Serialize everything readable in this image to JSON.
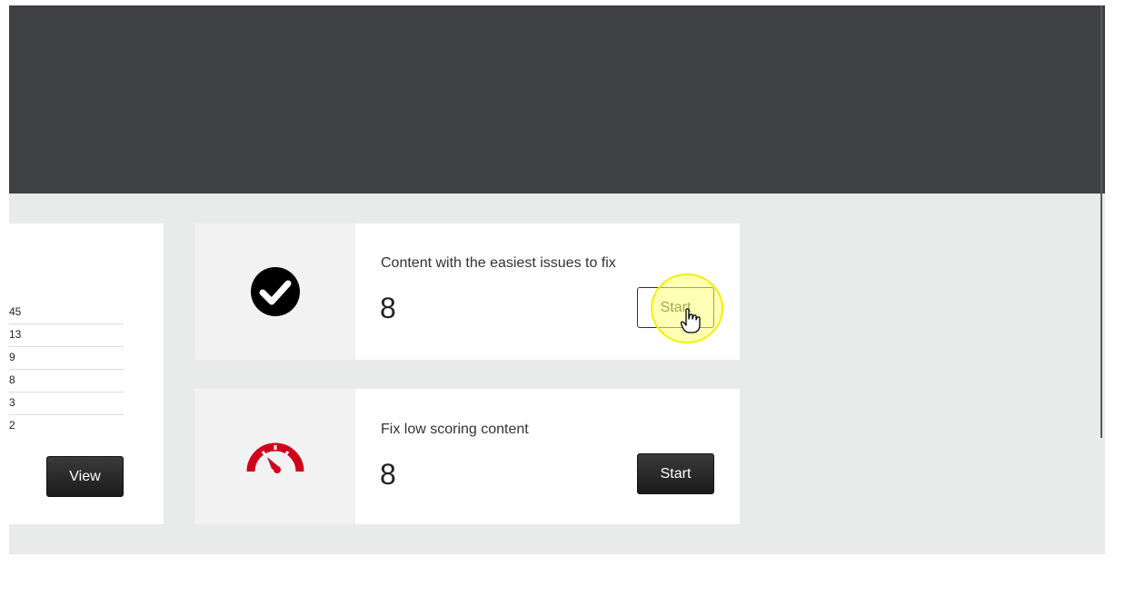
{
  "left_card": {
    "values": [
      "45",
      "13",
      "9",
      "8",
      "3",
      "2"
    ],
    "view_label": "View"
  },
  "tasks": [
    {
      "title": "Content with the easiest issues to fix",
      "count": "8",
      "button_label": "Start",
      "icon": "check-circle-icon",
      "icon_color": "#000000"
    },
    {
      "title": "Fix low scoring content",
      "count": "8",
      "button_label": "Start",
      "icon": "gauge-icon",
      "icon_color": "#d0021b"
    }
  ],
  "colors": {
    "header": "#3f4044",
    "background": "#e9eaea",
    "cursor_highlight": "#f2f200"
  }
}
